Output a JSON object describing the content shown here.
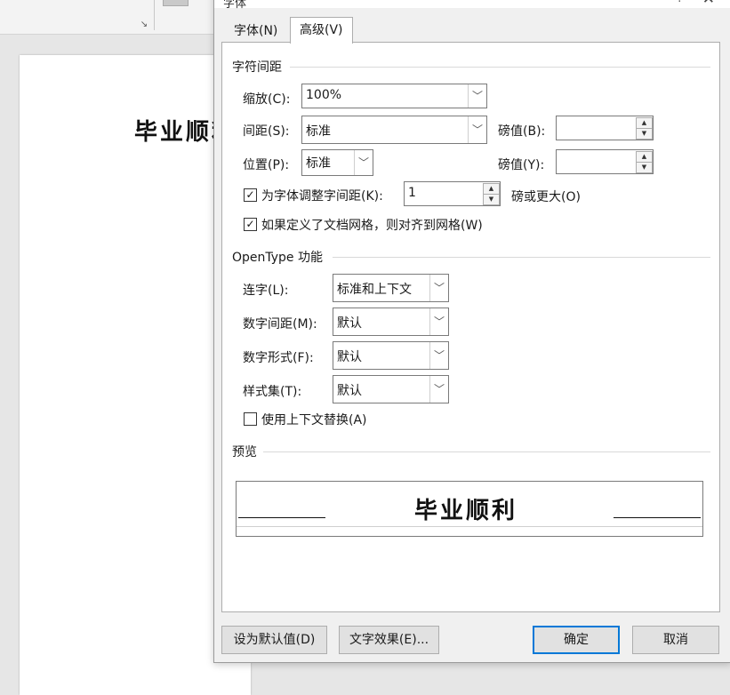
{
  "background_doc": {
    "text": "毕业顺利"
  },
  "dialog": {
    "title": "字体",
    "help_icon": "?",
    "close_icon": "✕",
    "tabs": [
      {
        "label": "字体(N)",
        "active": false
      },
      {
        "label": "高级(V)",
        "active": true
      }
    ],
    "char_spacing": {
      "section": "字符间距",
      "scale_label": "缩放(C):",
      "scale_value": "100%",
      "spacing_label": "间距(S):",
      "spacing_value": "标准",
      "spacing_by_label": "磅值(B):",
      "spacing_by_value": "",
      "position_label": "位置(P):",
      "position_value": "标准",
      "position_by_label": "磅值(Y):",
      "position_by_value": "",
      "kerning_label": "为字体调整字间距(K):",
      "kerning_checked": true,
      "kerning_value": "1",
      "kerning_suffix": "磅或更大(O)",
      "grid_label": "如果定义了文档网格，则对齐到网格(W)",
      "grid_checked": true
    },
    "opentype": {
      "section": "OpenType 功能",
      "ligatures_label": "连字(L):",
      "ligatures_value": "标准和上下文",
      "num_spacing_label": "数字间距(M):",
      "num_spacing_value": "默认",
      "num_forms_label": "数字形式(F):",
      "num_forms_value": "默认",
      "stylistic_label": "样式集(T):",
      "stylistic_value": "默认",
      "contextual_label": "使用上下文替换(A)",
      "contextual_checked": false
    },
    "preview": {
      "section": "预览",
      "text": "毕业顺利"
    },
    "buttons": {
      "set_default": "设为默认值(D)",
      "text_effects": "文字效果(E)...",
      "ok": "确定",
      "cancel": "取消"
    }
  }
}
